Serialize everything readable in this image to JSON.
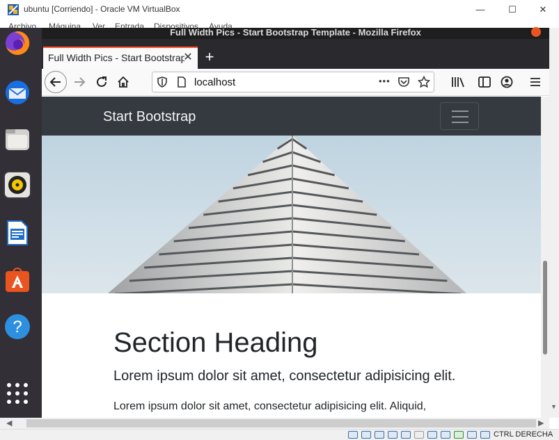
{
  "host_window": {
    "title": "ubuntu [Corriendo] - Oracle VM VirtualBox",
    "minimize_glyph": "—",
    "maximize_glyph": "☐",
    "close_glyph": "✕",
    "menu": [
      "Archivo",
      "Máquina",
      "Ver",
      "Entrada",
      "Dispositivos",
      "Ayuda"
    ],
    "status_hostkey": "CTRL DERECHA"
  },
  "guest_topbar": {
    "window_title": "Full Width Pics - Start Bootstrap Template - Mozilla Firefox"
  },
  "dock": {
    "items": [
      "firefox-icon",
      "thunderbird-icon",
      "files-icon",
      "rhythmbox-icon",
      "libreoffice-writer-icon",
      "ubuntu-software-icon",
      "help-icon",
      "show-apps-icon"
    ],
    "help_glyph": "?"
  },
  "browser": {
    "tab_title": "Full Width Pics - Start Bootstrap Template",
    "tab_close": "✕",
    "new_tab": "+",
    "url": "localhost",
    "page_actions_glyph": "•••"
  },
  "page": {
    "brand": "Start Bootstrap",
    "section_heading": "Section Heading",
    "lead": "Lorem ipsum dolor sit amet, consectetur adipisicing elit.",
    "body": "Lorem ipsum dolor sit amet, consectetur adipisicing elit. Aliquid,"
  },
  "colors": {
    "firefox_accent": "#ff4f2b",
    "navbar_dark": "#343a40",
    "ubuntu_orange": "#e95420"
  }
}
